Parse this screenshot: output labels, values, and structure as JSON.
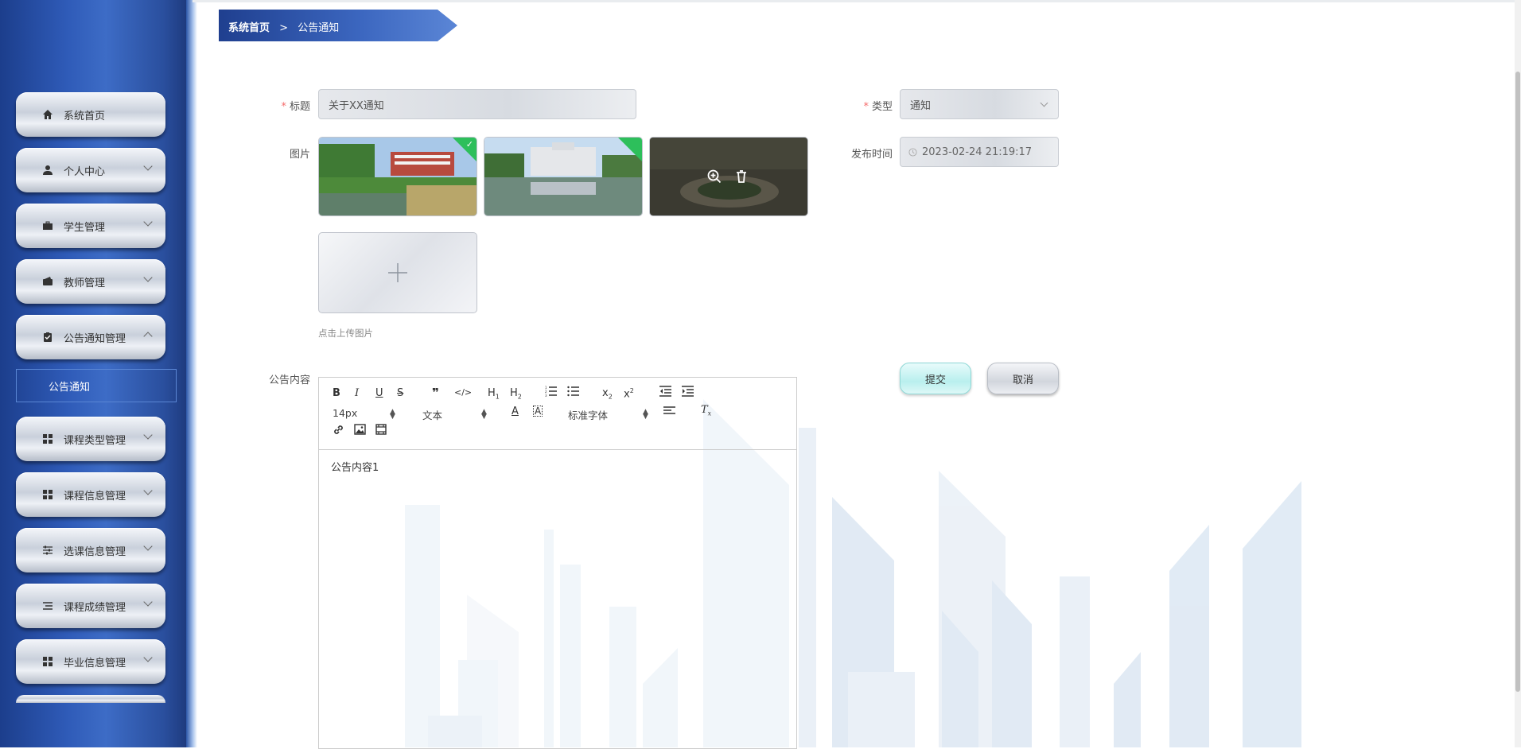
{
  "sidebar": {
    "items": [
      {
        "label": "系统首页",
        "icon": "home-icon"
      },
      {
        "label": "个人中心",
        "icon": "user-icon"
      },
      {
        "label": "学生管理",
        "icon": "briefcase-icon"
      },
      {
        "label": "教师管理",
        "icon": "wallet-icon"
      },
      {
        "label": "公告通知管理",
        "icon": "clipboard-icon"
      },
      {
        "label": "课程类型管理",
        "icon": "grid-icon"
      },
      {
        "label": "课程信息管理",
        "icon": "grid-icon"
      },
      {
        "label": "选课信息管理",
        "icon": "sliders-icon"
      },
      {
        "label": "课程成绩管理",
        "icon": "list-icon"
      },
      {
        "label": "毕业信息管理",
        "icon": "grid-icon"
      }
    ],
    "submenu": {
      "label": "公告通知"
    }
  },
  "breadcrumb": {
    "home": "系统首页",
    "separator": ">",
    "current": "公告通知"
  },
  "form": {
    "title_label": "标题",
    "title_value": "关于XX通知",
    "type_label": "类型",
    "type_value": "通知",
    "images_label": "图片",
    "upload_hint": "点击上传图片",
    "publish_time_label": "发布时间",
    "publish_time_value": "2023-02-24 21:19:17",
    "content_label": "公告内容",
    "content_value": "公告内容1",
    "submit_label": "提交",
    "cancel_label": "取消"
  },
  "editor": {
    "font_size": "14px",
    "header_select": "文本",
    "font_family": "标准字体"
  },
  "colors": {
    "accent": "#2f5bb8",
    "required": "#f56c6c",
    "submit_bg": "#c8f3f2"
  }
}
